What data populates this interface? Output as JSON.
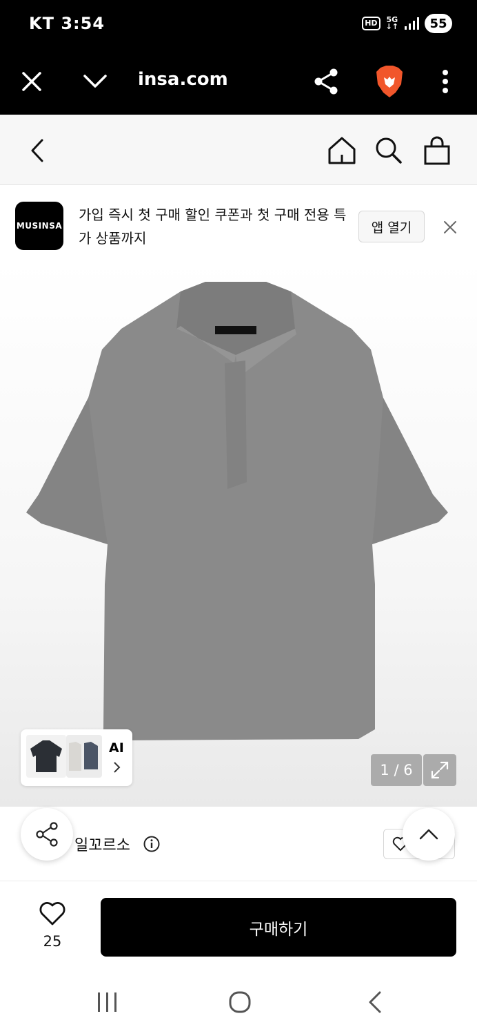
{
  "status_bar": {
    "carrier_time": "KT 3:54",
    "hd_label": "HD",
    "network_label": "5G",
    "battery": "55"
  },
  "browser": {
    "url": "insa.com",
    "icons": [
      "close-icon",
      "chevron-down-icon",
      "share-icon",
      "brave-lion-icon",
      "more-vert-icon"
    ]
  },
  "site_header": {
    "icons": [
      "back-icon",
      "home-icon",
      "search-icon",
      "shopping-bag-icon"
    ]
  },
  "app_banner": {
    "logo_text": "MUSINSA",
    "message": "가입 즉시 첫 구매 할인 쿠폰과 첫 구매 전용 특가 상품까지",
    "open_button": "앱 열기",
    "close_icon": "close-icon"
  },
  "gallery": {
    "ai_label": "AI",
    "counter": "1 / 6",
    "colors": {
      "shirt": "#8a8a8a",
      "thumb_dark": "#2b2f35",
      "thumb_light": "#d9d7d3",
      "thumb_navy": "#4b5566"
    }
  },
  "product": {
    "brand": "일꼬르소"
  },
  "purchase": {
    "like_count": "25",
    "buy_label": "구매하기"
  },
  "colors": {
    "accent": "#000000"
  }
}
